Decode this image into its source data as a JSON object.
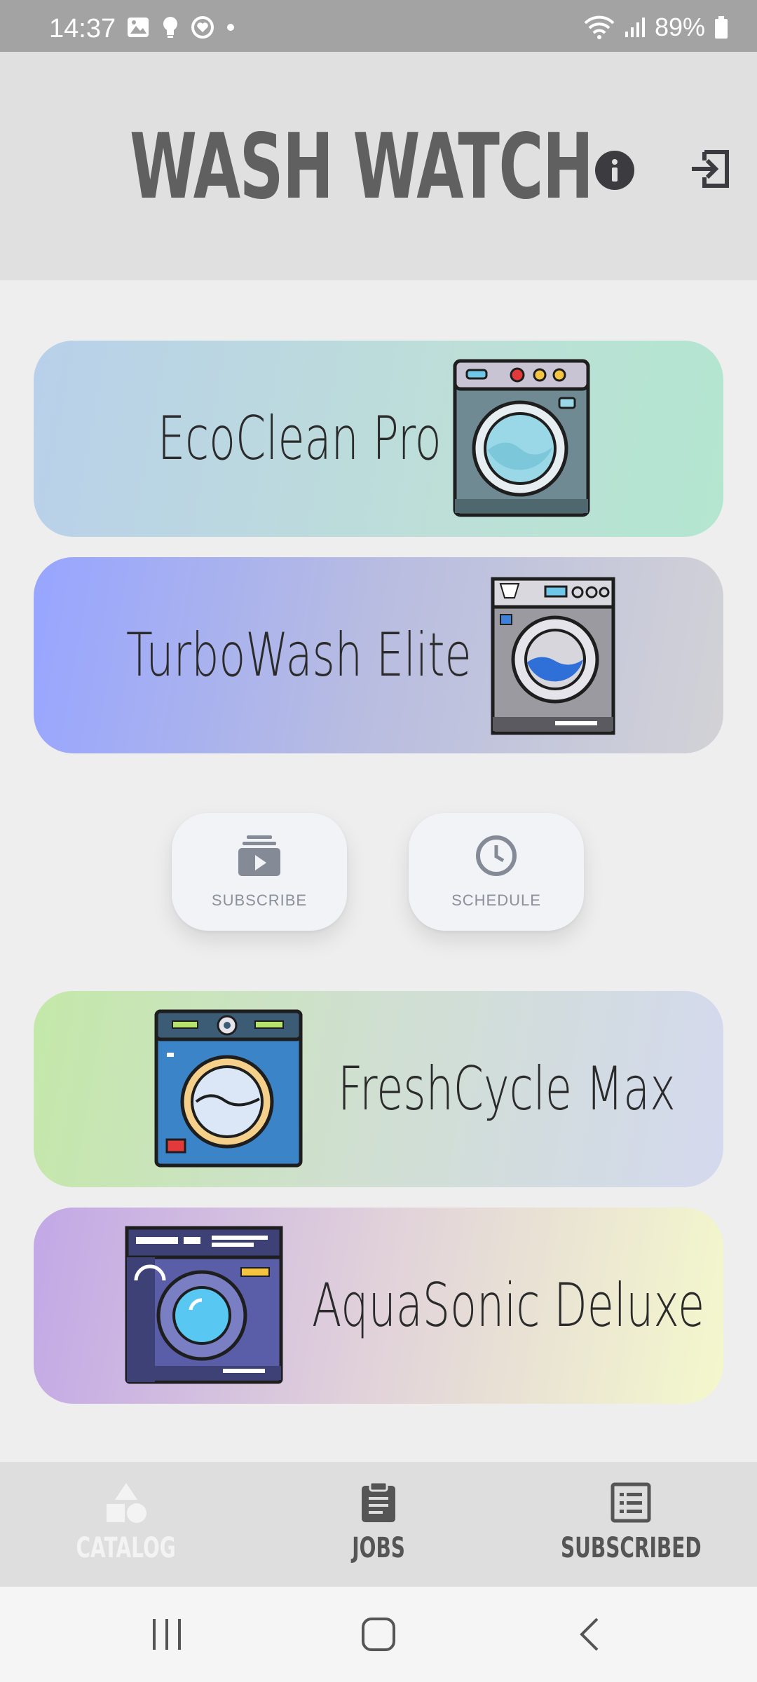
{
  "status_bar": {
    "time": "14:37",
    "battery_percent": "89%",
    "icons": [
      "image-icon",
      "lightbulb-icon",
      "heart-sync-icon",
      "dot-icon",
      "wifi-icon",
      "signal-icon",
      "battery-icon"
    ]
  },
  "header": {
    "title": "WASH WATCH",
    "info_icon": "info-icon",
    "logout_icon": "logout-icon"
  },
  "machines": [
    {
      "name": "EcoClean Pro"
    },
    {
      "name": "TurboWash Elite"
    },
    {
      "name": "FreshCycle Max"
    },
    {
      "name": "AquaSonic Deluxe"
    }
  ],
  "actions": {
    "subscribe_label": "SUBSCRIBE",
    "schedule_label": "SCHEDULE"
  },
  "bottom_nav": {
    "items": [
      {
        "label": "CATALOG",
        "icon": "shapes-icon",
        "active": true
      },
      {
        "label": "JOBS",
        "icon": "clipboard-icon",
        "active": false
      },
      {
        "label": "SUBSCRIBED",
        "icon": "list-icon",
        "active": false
      }
    ]
  },
  "colors": {
    "header_bg": "#e0e0e0",
    "page_bg": "#eeeeee",
    "title": "#606060",
    "active_nav": "#f3f3f3"
  }
}
